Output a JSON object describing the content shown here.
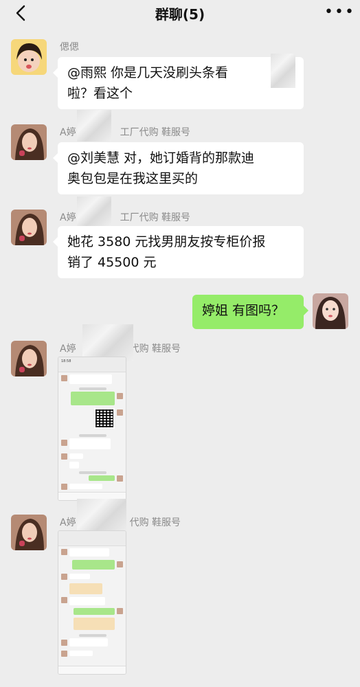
{
  "header": {
    "title": "群聊(5)",
    "back_icon": "chevron-left-icon",
    "more_icon": "more-dots-icon"
  },
  "messages": [
    {
      "sender": "偲偲",
      "text_line1": "@雨熙  你是几天没刷头条看",
      "text_line2": "啦？看这个"
    },
    {
      "sender": "A婷",
      "sender_suffix": "工厂代购 鞋服号",
      "text_line1": "@刘美慧  对，她订婚背的那款迪",
      "text_line2": "奥包包是在我这里买的"
    },
    {
      "sender": "A婷",
      "sender_suffix": "工厂代购 鞋服号",
      "text_line1": "她花 3580 元找男朋友按专柜价报",
      "text_line2": "销了 45500 元"
    },
    {
      "self": true,
      "text": "婷姐  有图吗？"
    },
    {
      "sender": "A婷",
      "sender_suffix": "代购 鞋服号",
      "type": "image",
      "shot_time": "18:58"
    },
    {
      "sender": "A婷",
      "sender_suffix": "代购 鞋服号",
      "type": "image"
    }
  ],
  "colors": {
    "background": "#ededed",
    "self_bubble": "#95ec69",
    "other_bubble": "#ffffff"
  }
}
